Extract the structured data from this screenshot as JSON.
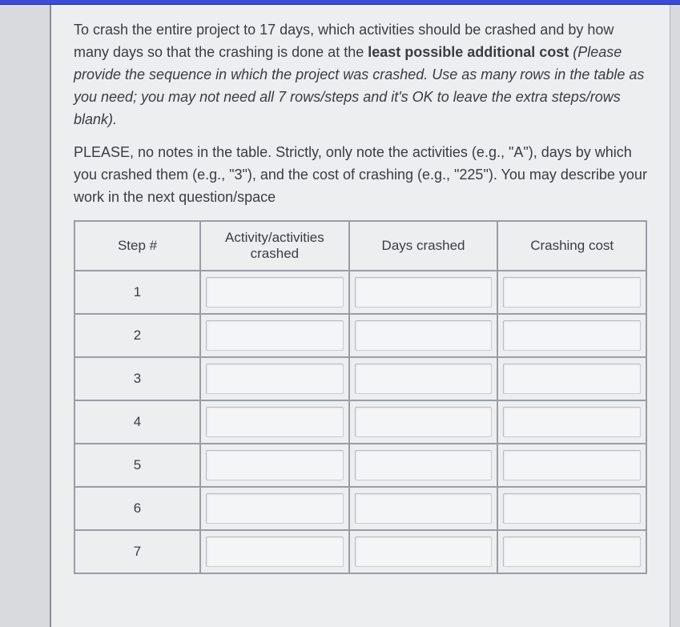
{
  "question": {
    "p1_part1": "To crash the entire project to 17 days, which activities should be crashed and by how many days so that the crashing is done at the ",
    "p1_bold": "least possible additional cost",
    "p1_part2": " (Please provide the sequence in which the project was crashed. Use as many rows in the table as you need; you may not need all 7 rows/steps and it's OK to leave the extra steps/rows blank).",
    "p2": "PLEASE, no notes in the table. Strictly, only note the activities (e.g., \"A\"), days by which you crashed them (e.g., \"3\"), and the cost of crashing (e.g., \"225\"). You may describe your work in the next question/space"
  },
  "table": {
    "headers": {
      "step": "Step #",
      "activity": "Activity/activities crashed",
      "days": "Days crashed",
      "cost": "Crashing cost"
    },
    "rows": [
      {
        "step": "1",
        "activity": "",
        "days": "",
        "cost": ""
      },
      {
        "step": "2",
        "activity": "",
        "days": "",
        "cost": ""
      },
      {
        "step": "3",
        "activity": "",
        "days": "",
        "cost": ""
      },
      {
        "step": "4",
        "activity": "",
        "days": "",
        "cost": ""
      },
      {
        "step": "5",
        "activity": "",
        "days": "",
        "cost": ""
      },
      {
        "step": "6",
        "activity": "",
        "days": "",
        "cost": ""
      },
      {
        "step": "7",
        "activity": "",
        "days": "",
        "cost": ""
      }
    ]
  }
}
